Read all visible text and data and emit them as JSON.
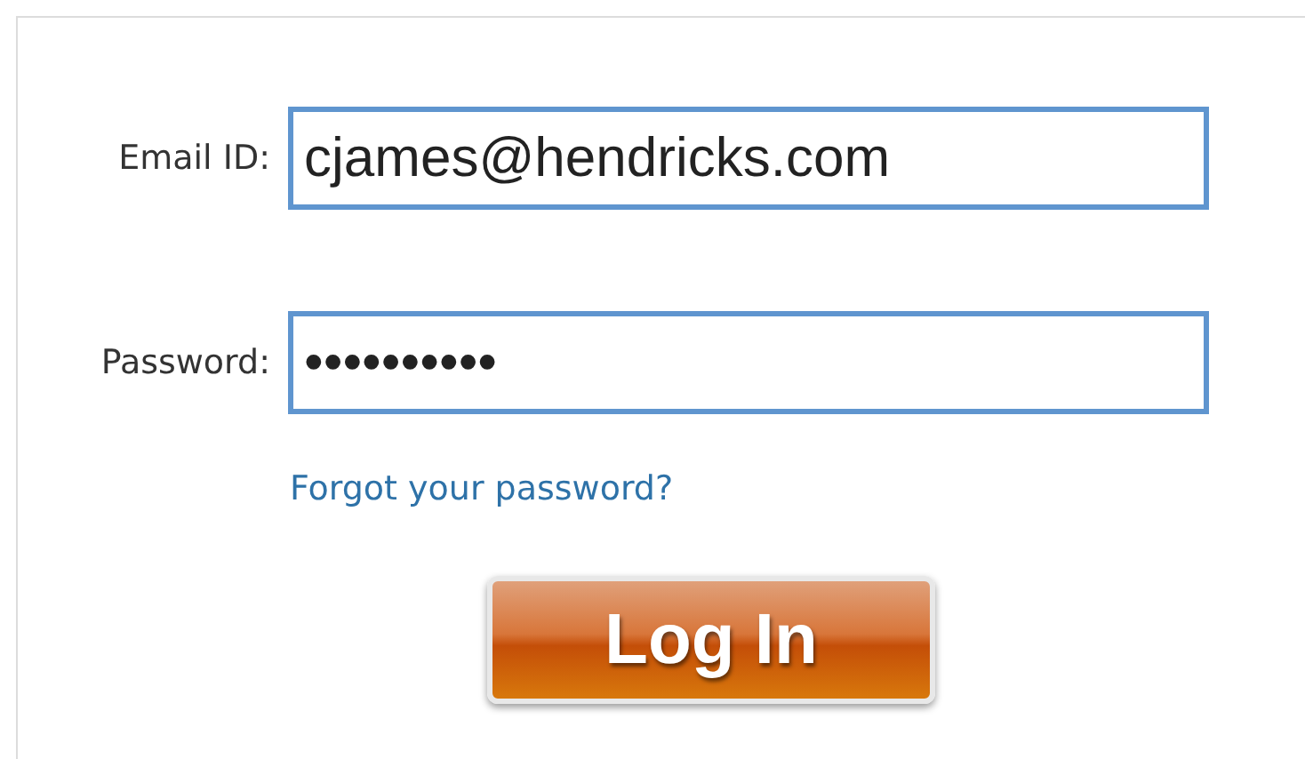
{
  "form": {
    "email": {
      "label": "Email ID:",
      "value": "cjames@hendricks.com"
    },
    "password": {
      "label": "Password:",
      "value": "••••••••••"
    },
    "forgot_link": "Forgot your password?",
    "login_button": "Log In"
  }
}
